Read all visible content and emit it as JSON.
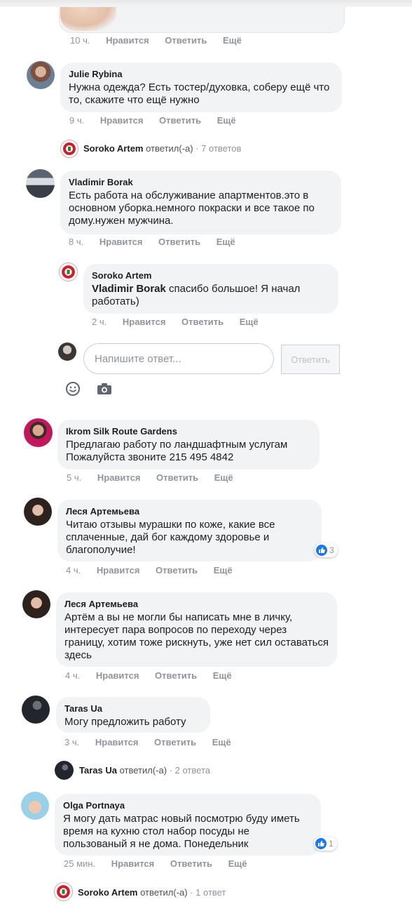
{
  "actions": {
    "like": "Нравится",
    "reply": "Ответить",
    "more": "Ещё"
  },
  "top_comment": {
    "time": "10 ч."
  },
  "comments": [
    {
      "id": "julie",
      "name": "Julie Rybina",
      "text": "Нужна одежда? Есть тостер/духовка, соберу ещё что то, скажите что ещё нужно",
      "time": "9 ч."
    },
    {
      "id": "vladimir",
      "name": "Vladimir Borak",
      "text": "Есть работа на обслуживание апартментов.это в основном уборка.немного покраски и все такое по дому.нужен мужчина.",
      "time": "8 ч."
    },
    {
      "id": "ikrom",
      "name": "Ikrom Silk Route Gardens",
      "text": "Предлагаю работу по ландшафтным услугам Пожалуйста звоните 215 495 4842",
      "time": "5 ч."
    },
    {
      "id": "lesya1",
      "name": "Леся Артемьева",
      "text": "Читаю отзывы мурашки по коже, какие все сплаченные, дай бог каждому здоровье и благополучие!",
      "time": "4 ч.",
      "reactions": "3"
    },
    {
      "id": "lesya2",
      "name": "Леся Артемьева",
      "text": "Артём а вы не могли бы написать мне в личку, интересует пара вопросов по переходу через границу, хотим тоже рискнуть, уже нет сил оставаться здесь",
      "time": "4 ч."
    },
    {
      "id": "taras",
      "name": "Taras Ua",
      "text": "Могу предложить работу",
      "time": "3 ч."
    },
    {
      "id": "olga",
      "name": "Olga Portnaya",
      "text": "Я могу дать матрас новый посмотрю буду иметь время на кухню стол набор посуды не пользованый я не дома. Понедельник",
      "time": "25 мин.",
      "reactions": "1"
    }
  ],
  "reply_summaries": {
    "julie": {
      "name": "Soroko Artem",
      "verb": "ответил(-а)",
      "sep": " · ",
      "count": "7 ответов"
    },
    "taras": {
      "name": "Taras Ua",
      "verb": "ответил(-а)",
      "sep": " · ",
      "count": "2 ответа"
    },
    "olga": {
      "name": "Soroko Artem",
      "verb": "ответил(-а)",
      "sep": " · ",
      "count": "1 ответ"
    }
  },
  "nested_reply": {
    "name": "Soroko Artem",
    "mention": "Vladimir Borak",
    "text": " спасибо большое! Я начал работать)",
    "time": "2 ч."
  },
  "reply_box": {
    "placeholder": "Напишите ответ...",
    "button": "Ответить"
  },
  "icons": {
    "emoji": "smiley-icon",
    "photo": "camera-icon",
    "like": "like-icon"
  },
  "colors": {
    "bubble": "#f2f3f5",
    "meta": "#90949c",
    "like_blue": "#1877f2",
    "crest_red": "#c8202e"
  }
}
